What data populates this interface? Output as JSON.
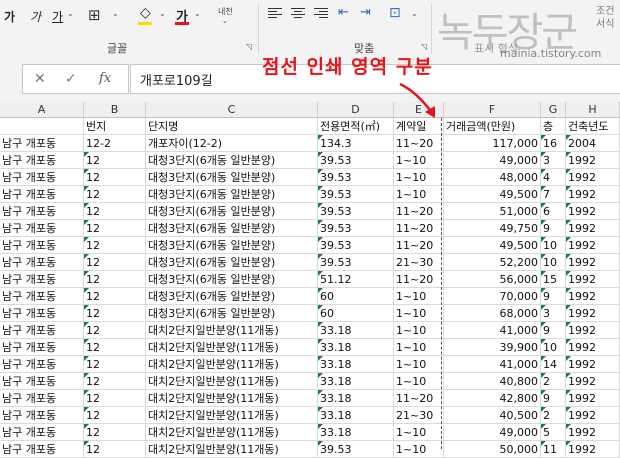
{
  "ribbon": {
    "font_buttons": [
      "가",
      "가",
      "가",
      "내천"
    ],
    "font_group_label": "글꼴",
    "align_group_label": "맞춤",
    "number_group_label": "표시 형식",
    "format_partial": "조건",
    "format_partial2": "서식"
  },
  "formula_bar": {
    "cancel_icon": "close-icon",
    "enter_icon": "check-icon",
    "fx_label": "fx",
    "value": "개포로109길"
  },
  "annotation": {
    "text": "점선 인쇄 영역 구분"
  },
  "watermark": {
    "text": "녹두장군",
    "url": "mainia.tistory.com"
  },
  "columns": [
    {
      "letter": "A",
      "header": ""
    },
    {
      "letter": "B",
      "header": "번지"
    },
    {
      "letter": "C",
      "header": "단지명"
    },
    {
      "letter": "D",
      "header": "전용면적(㎡)"
    },
    {
      "letter": "E",
      "header": "계약일"
    },
    {
      "letter": "F",
      "header": "거래금액(만원)"
    },
    {
      "letter": "G",
      "header": "층"
    },
    {
      "letter": "H",
      "header": "건축년도"
    }
  ],
  "rows": [
    [
      "남구 개포동",
      "12-2",
      "개포자이(12-2)",
      "134.3",
      "11~20",
      "117,000",
      "16",
      "2004"
    ],
    [
      "남구 개포동",
      "12",
      "대청3단지(6개동 일반분양)",
      "39.53",
      "1~10",
      "49,000",
      "3",
      "1992"
    ],
    [
      "남구 개포동",
      "12",
      "대청3단지(6개동 일반분양)",
      "39.53",
      "1~10",
      "48,000",
      "4",
      "1992"
    ],
    [
      "남구 개포동",
      "12",
      "대청3단지(6개동 일반분양)",
      "39.53",
      "1~10",
      "49,500",
      "7",
      "1992"
    ],
    [
      "남구 개포동",
      "12",
      "대청3단지(6개동 일반분양)",
      "39.53",
      "11~20",
      "51,000",
      "6",
      "1992"
    ],
    [
      "남구 개포동",
      "12",
      "대청3단지(6개동 일반분양)",
      "39.53",
      "11~20",
      "49,750",
      "9",
      "1992"
    ],
    [
      "남구 개포동",
      "12",
      "대청3단지(6개동 일반분양)",
      "39.53",
      "11~20",
      "49,500",
      "10",
      "1992"
    ],
    [
      "남구 개포동",
      "12",
      "대청3단지(6개동 일반분양)",
      "39.53",
      "21~30",
      "52,200",
      "10",
      "1992"
    ],
    [
      "남구 개포동",
      "12",
      "대청3단지(6개동 일반분양)",
      "51.12",
      "11~20",
      "56,000",
      "15",
      "1992"
    ],
    [
      "남구 개포동",
      "12",
      "대청3단지(6개동 일반분양)",
      "60",
      "1~10",
      "70,000",
      "9",
      "1992"
    ],
    [
      "남구 개포동",
      "12",
      "대청3단지(6개동 일반분양)",
      "60",
      "1~10",
      "68,000",
      "3",
      "1992"
    ],
    [
      "남구 개포동",
      "12",
      "대치2단지일반분양(11개동)",
      "33.18",
      "1~10",
      "41,000",
      "9",
      "1992"
    ],
    [
      "남구 개포동",
      "12",
      "대치2단지일반분양(11개동)",
      "33.18",
      "1~10",
      "39,900",
      "10",
      "1992"
    ],
    [
      "남구 개포동",
      "12",
      "대치2단지일반분양(11개동)",
      "33.18",
      "1~10",
      "41,000",
      "14",
      "1992"
    ],
    [
      "남구 개포동",
      "12",
      "대치2단지일반분양(11개동)",
      "33.18",
      "1~10",
      "40,800",
      "2",
      "1992"
    ],
    [
      "남구 개포동",
      "12",
      "대치2단지일반분양(11개동)",
      "33.18",
      "11~20",
      "42,800",
      "9",
      "1992"
    ],
    [
      "남구 개포동",
      "12",
      "대치2단지일반분양(11개동)",
      "33.18",
      "21~30",
      "40,500",
      "2",
      "1992"
    ],
    [
      "남구 개포동",
      "12",
      "대치2단지일반분양(11개동)",
      "33.18",
      "1~10",
      "49,000",
      "5",
      "1992"
    ],
    [
      "남구 개포동",
      "12",
      "대치2단지일반분양(11개동)",
      "39.53",
      "1~10",
      "50,000",
      "11",
      "1992"
    ]
  ],
  "colors": {
    "annotation": "#e8131a",
    "error_triangle": "#1a7f3c",
    "font_color_bar": "#e8131a",
    "fill_color_bar": "#ffd800"
  }
}
